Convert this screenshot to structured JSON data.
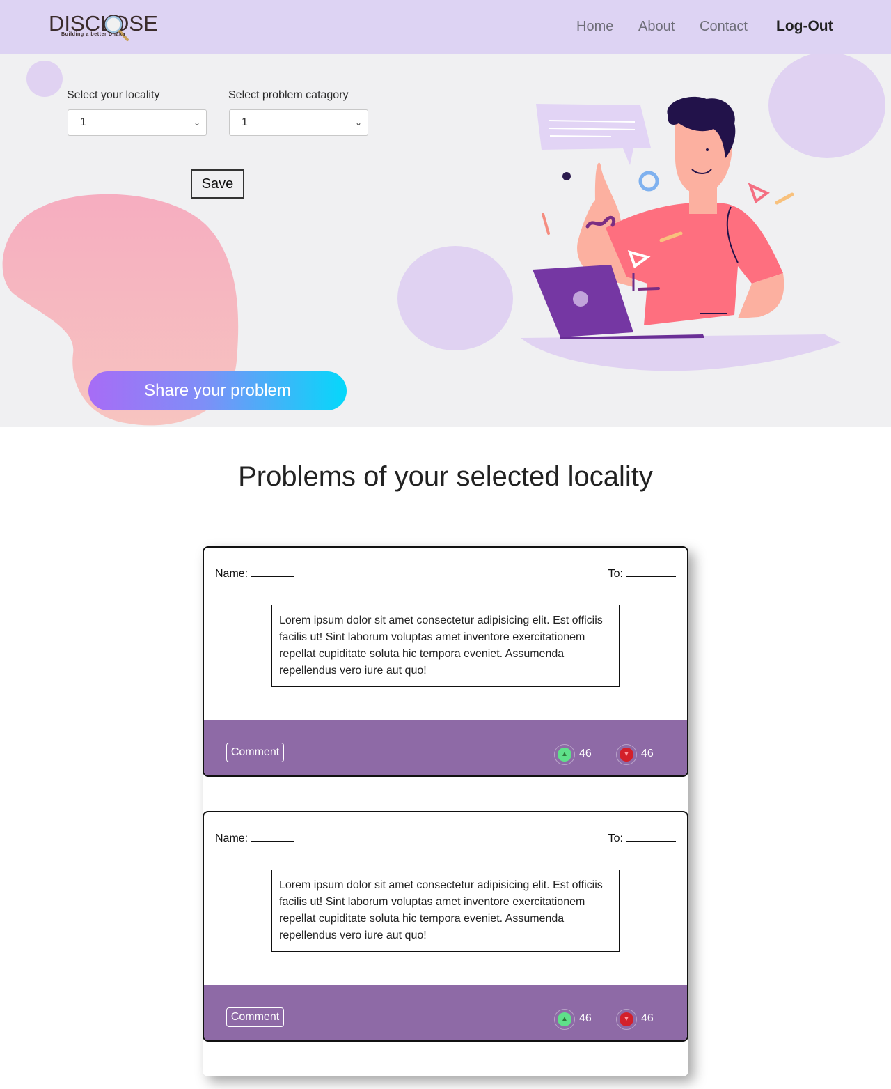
{
  "navbar": {
    "logo_text": "DISCLOSE",
    "logo_tagline": "Building a better Dhaka",
    "links": {
      "home": "Home",
      "about": "About",
      "contact": "Contact",
      "logout": "Log-Out"
    }
  },
  "hero": {
    "locality_label": "Select your locality",
    "locality_value": "1",
    "category_label": "Select problem catagory",
    "category_value": "1",
    "save_label": "Save",
    "share_label": "Share your problem"
  },
  "section": {
    "title": "Problems of your selected locality"
  },
  "posts": [
    {
      "name_label": "Name:",
      "to_label": "To:",
      "description": "Lorem ipsum dolor sit amet consectetur adipisicing elit. Est officiis facilis ut! Sint laborum voluptas amet inventore exercitationem repellat cupiditate soluta hic tempora eveniet. Assumenda repellendus vero iure aut quo!",
      "comment_label": "Comment",
      "upvotes": "46",
      "downvotes": "46"
    },
    {
      "name_label": "Name:",
      "to_label": "To:",
      "description": "Lorem ipsum dolor sit amet consectetur adipisicing elit. Est officiis facilis ut! Sint laborum voluptas amet inventore exercitationem repellat cupiditate soluta hic tempora eveniet. Assumenda repellendus vero iure aut quo!",
      "comment_label": "Comment",
      "upvotes": "46",
      "downvotes": "46"
    }
  ],
  "icons": {
    "select_arrow": "chevron-down-icon",
    "upvote": "thumbs-up-icon",
    "downvote": "thumbs-down-icon",
    "logo_mark": "magnifier-icon",
    "illustration": "person-with-laptop-illustration"
  },
  "colors": {
    "navbar_bg": "#ddd3f3",
    "hero_bg": "#f0f0f2",
    "card_footer": "#8e6aa6",
    "share_gradient_start": "#a76cf6",
    "share_gradient_end": "#05d8fa",
    "upvote": "#5fe08a",
    "downvote": "#d3202a"
  }
}
